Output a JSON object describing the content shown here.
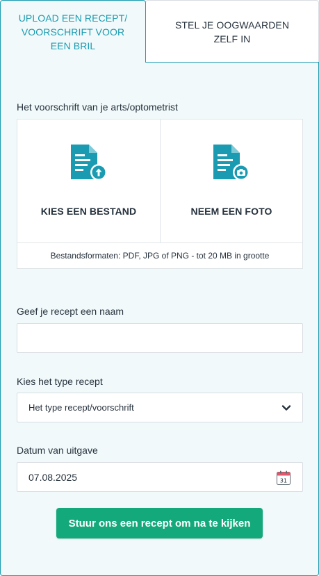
{
  "tabs": {
    "upload_label": "UPLOAD EEN RECEPT/ VOORSCHRIFT VOOR EEN BRIL",
    "manual_label": "STEL JE OOGWAARDEN ZELF IN"
  },
  "upload": {
    "section_label": "Het voorschrift van je arts/optometrist",
    "choose_file_label": "KIES EEN BESTAND",
    "take_photo_label": "NEEM EEN FOTO",
    "formats_note": "Bestandsformaten: PDF, JPG of PNG - tot 20 MB in grootte"
  },
  "name_field": {
    "label": "Geef je recept een naam",
    "value": ""
  },
  "type_field": {
    "label": "Kies het type recept",
    "selected": "Het type recept/voorschrift"
  },
  "date_field": {
    "label": "Datum van uitgave",
    "value": "07.08.2025",
    "calendar_day": "31"
  },
  "submit_label": "Stuur ons een recept om na te kijken",
  "icons": {
    "file_upload": "file-upload-icon",
    "camera": "camera-file-icon",
    "chevron": "chevron-down-icon",
    "calendar": "calendar-icon"
  },
  "colors": {
    "accent": "#1a9bb1",
    "panel_bg": "#f1f9fa",
    "submit": "#14a97b",
    "text": "#26323d"
  }
}
